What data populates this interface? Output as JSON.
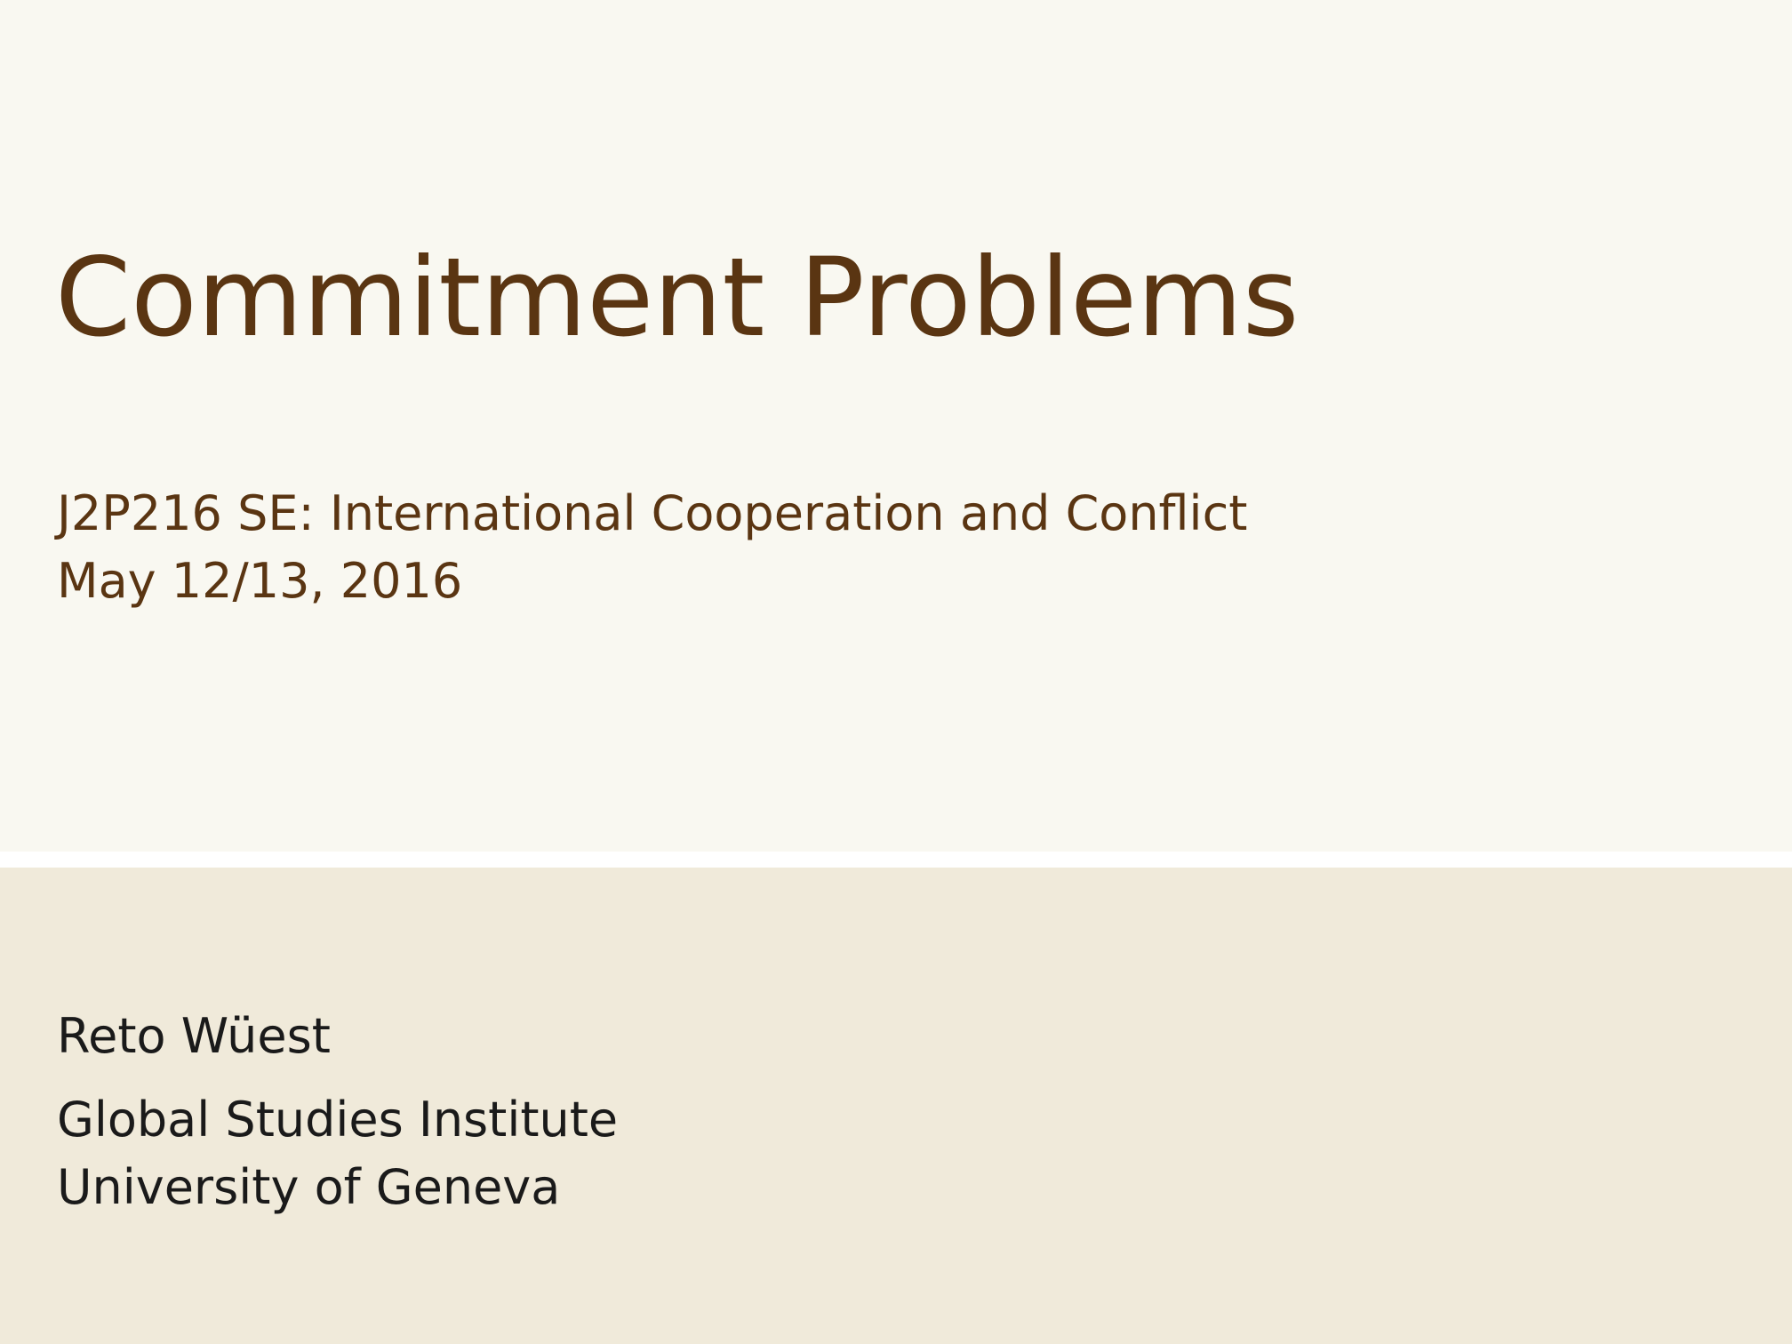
{
  "slide": {
    "title": "Commitment Problems",
    "subtitle": "J2P216 SE: International Cooperation and Conflict",
    "date": "May 12/13, 2016",
    "author": "Reto Wüest",
    "institute": "Global Studies Institute",
    "university": "University of Geneva"
  },
  "colors": {
    "title_text": "#5a3512",
    "upper_background": "#f9f8f1",
    "lower_background": "#f0eada",
    "divider": "#ffffff",
    "body_text": "#1a1a1a"
  }
}
